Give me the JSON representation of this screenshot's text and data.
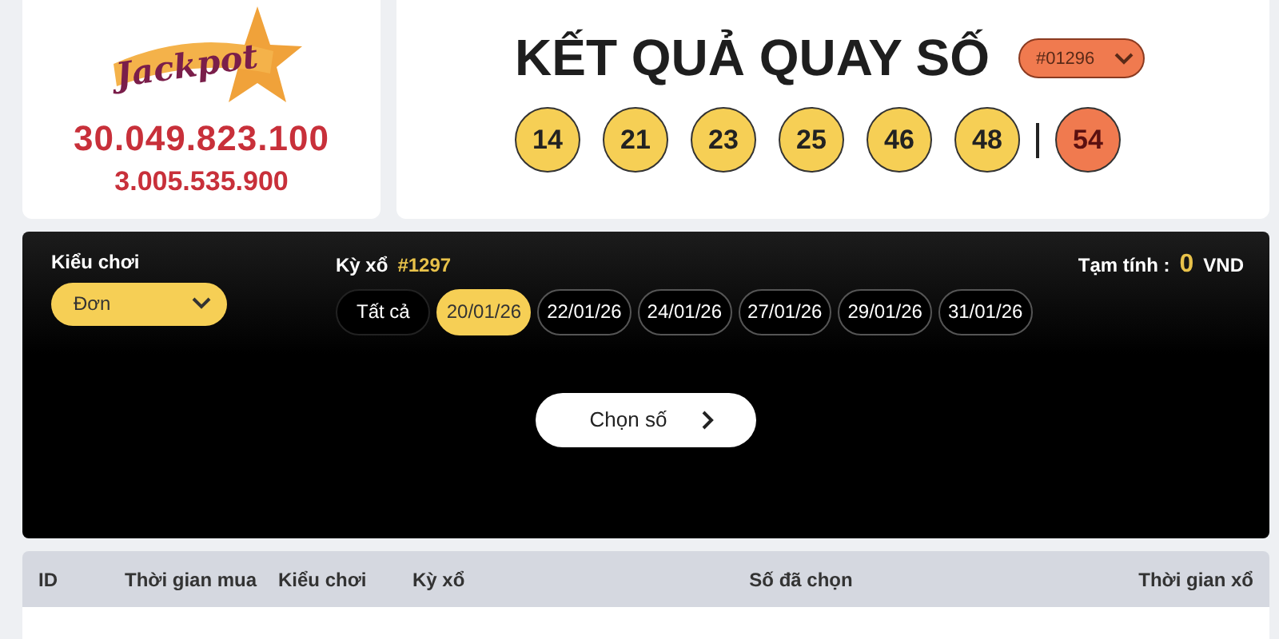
{
  "jackpot": {
    "logo_text": "Jackpot",
    "amount_1": "30.049.823.100",
    "amount_2": "3.005.535.900"
  },
  "result": {
    "title": "KẾT QUẢ QUAY SỐ",
    "draw_select": "#01296",
    "balls": [
      {
        "number": "14",
        "kind": "main"
      },
      {
        "number": "21",
        "kind": "main"
      },
      {
        "number": "23",
        "kind": "main"
      },
      {
        "number": "25",
        "kind": "main"
      },
      {
        "number": "46",
        "kind": "main"
      },
      {
        "number": "48",
        "kind": "main"
      },
      {
        "number": "54",
        "kind": "bonus"
      }
    ]
  },
  "play": {
    "type_label": "Kiểu chơi",
    "type_value": "Đơn",
    "draw_label": "Kỳ xổ",
    "draw_number": "#1297",
    "dates": [
      {
        "label": "Tất cả",
        "selected": false,
        "kind": "all"
      },
      {
        "label": "20/01/26",
        "selected": true,
        "kind": "date"
      },
      {
        "label": "22/01/26",
        "selected": false,
        "kind": "date"
      },
      {
        "label": "24/01/26",
        "selected": false,
        "kind": "date"
      },
      {
        "label": "27/01/26",
        "selected": false,
        "kind": "date"
      },
      {
        "label": "29/01/26",
        "selected": false,
        "kind": "date"
      },
      {
        "label": "31/01/26",
        "selected": false,
        "kind": "date"
      }
    ],
    "total_label": "Tạm tính :",
    "total_value": "0",
    "total_unit": "VND",
    "choose_button": "Chọn số"
  },
  "table": {
    "columns": [
      "ID",
      "Thời gian mua",
      "Kiểu chơi",
      "Kỳ xổ",
      "Số đã chọn",
      "Thời gian xổ"
    ]
  }
}
